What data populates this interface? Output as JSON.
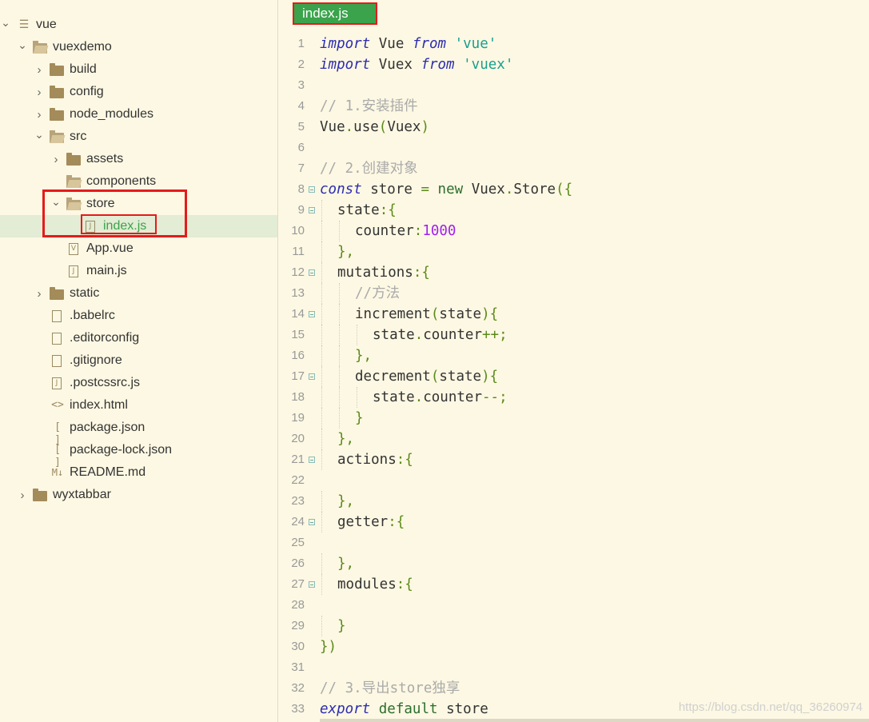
{
  "sidebar": {
    "tree": [
      {
        "label": "vue",
        "depth": 0,
        "icon": "file-list-icon",
        "chevron": "down",
        "selected": false
      },
      {
        "label": "vuexdemo",
        "depth": 1,
        "icon": "folder-open-icon",
        "chevron": "down",
        "selected": false
      },
      {
        "label": "build",
        "depth": 2,
        "icon": "folder-icon",
        "chevron": "right",
        "selected": false
      },
      {
        "label": "config",
        "depth": 2,
        "icon": "folder-icon",
        "chevron": "right",
        "selected": false
      },
      {
        "label": "node_modules",
        "depth": 2,
        "icon": "folder-icon",
        "chevron": "right",
        "selected": false
      },
      {
        "label": "src",
        "depth": 2,
        "icon": "folder-open-icon",
        "chevron": "down",
        "selected": false
      },
      {
        "label": "assets",
        "depth": 3,
        "icon": "folder-icon",
        "chevron": "right",
        "selected": false
      },
      {
        "label": "components",
        "depth": 3,
        "icon": "folder-open-icon",
        "chevron": "",
        "selected": false
      },
      {
        "label": "store",
        "depth": 3,
        "icon": "folder-open-icon",
        "chevron": "down",
        "selected": false
      },
      {
        "label": "index.js",
        "depth": 4,
        "icon": "js-file-icon",
        "chevron": "",
        "selected": true
      },
      {
        "label": "App.vue",
        "depth": 3,
        "icon": "vue-file-icon",
        "chevron": "",
        "selected": false
      },
      {
        "label": "main.js",
        "depth": 3,
        "icon": "js-file-icon",
        "chevron": "",
        "selected": false
      },
      {
        "label": "static",
        "depth": 2,
        "icon": "folder-icon",
        "chevron": "right",
        "selected": false
      },
      {
        "label": ".babelrc",
        "depth": 2,
        "icon": "file-icon",
        "chevron": "",
        "selected": false
      },
      {
        "label": ".editorconfig",
        "depth": 2,
        "icon": "file-icon",
        "chevron": "",
        "selected": false
      },
      {
        "label": ".gitignore",
        "depth": 2,
        "icon": "file-icon",
        "chevron": "",
        "selected": false
      },
      {
        "label": ".postcssrc.js",
        "depth": 2,
        "icon": "js-file-icon",
        "chevron": "",
        "selected": false
      },
      {
        "label": "index.html",
        "depth": 2,
        "icon": "html-file-icon",
        "chevron": "",
        "selected": false
      },
      {
        "label": "package.json",
        "depth": 2,
        "icon": "json-file-icon",
        "chevron": "",
        "selected": false
      },
      {
        "label": "package-lock.json",
        "depth": 2,
        "icon": "json-file-icon",
        "chevron": "",
        "selected": false
      },
      {
        "label": "README.md",
        "depth": 2,
        "icon": "markdown-file-icon",
        "chevron": "",
        "selected": false
      },
      {
        "label": "wyxtabbar",
        "depth": 1,
        "icon": "folder-icon",
        "chevron": "right",
        "selected": false
      }
    ]
  },
  "editor": {
    "tab_label": "index.js",
    "lines": [
      {
        "n": "1",
        "fold": false,
        "indent": 0,
        "tokens": [
          [
            "kw",
            "import"
          ],
          [
            "plain",
            " Vue "
          ],
          [
            "kw",
            "from"
          ],
          [
            "plain",
            " "
          ],
          [
            "str",
            "'vue'"
          ]
        ]
      },
      {
        "n": "2",
        "fold": false,
        "indent": 0,
        "tokens": [
          [
            "kw",
            "import"
          ],
          [
            "plain",
            " Vuex "
          ],
          [
            "kw",
            "from"
          ],
          [
            "plain",
            " "
          ],
          [
            "str",
            "'vuex'"
          ]
        ]
      },
      {
        "n": "3",
        "fold": false,
        "indent": 0,
        "tokens": []
      },
      {
        "n": "4",
        "fold": false,
        "indent": 0,
        "tokens": [
          [
            "cmt",
            "// 1.安装插件"
          ]
        ]
      },
      {
        "n": "5",
        "fold": false,
        "indent": 0,
        "tokens": [
          [
            "plain",
            "Vue"
          ],
          [
            "pn",
            "."
          ],
          [
            "plain",
            "use"
          ],
          [
            "pn",
            "("
          ],
          [
            "plain",
            "Vuex"
          ],
          [
            "pn",
            ")"
          ]
        ]
      },
      {
        "n": "6",
        "fold": false,
        "indent": 0,
        "tokens": []
      },
      {
        "n": "7",
        "fold": false,
        "indent": 0,
        "tokens": [
          [
            "cmt",
            "// 2.创建对象"
          ]
        ]
      },
      {
        "n": "8",
        "fold": true,
        "indent": 0,
        "tokens": [
          [
            "kw",
            "const"
          ],
          [
            "plain",
            " store "
          ],
          [
            "pn",
            "="
          ],
          [
            "plain",
            " "
          ],
          [
            "kw2",
            "new"
          ],
          [
            "plain",
            " Vuex"
          ],
          [
            "pn",
            "."
          ],
          [
            "plain",
            "Store"
          ],
          [
            "pn",
            "({"
          ]
        ]
      },
      {
        "n": "9",
        "fold": true,
        "indent": 1,
        "tokens": [
          [
            "plain",
            "state"
          ],
          [
            "pn",
            ":{"
          ]
        ]
      },
      {
        "n": "10",
        "fold": false,
        "indent": 2,
        "tokens": [
          [
            "plain",
            "counter"
          ],
          [
            "pn",
            ":"
          ],
          [
            "num",
            "1000"
          ]
        ]
      },
      {
        "n": "11",
        "fold": false,
        "indent": 1,
        "tokens": [
          [
            "pn",
            "},"
          ]
        ]
      },
      {
        "n": "12",
        "fold": true,
        "indent": 1,
        "tokens": [
          [
            "plain",
            "mutations"
          ],
          [
            "pn",
            ":{"
          ]
        ]
      },
      {
        "n": "13",
        "fold": false,
        "indent": 2,
        "tokens": [
          [
            "cmt",
            "//方法"
          ]
        ]
      },
      {
        "n": "14",
        "fold": true,
        "indent": 2,
        "tokens": [
          [
            "plain",
            "increment"
          ],
          [
            "pn",
            "("
          ],
          [
            "plain",
            "state"
          ],
          [
            "pn",
            "){"
          ]
        ]
      },
      {
        "n": "15",
        "fold": false,
        "indent": 3,
        "tokens": [
          [
            "plain",
            "state"
          ],
          [
            "pn",
            "."
          ],
          [
            "plain",
            "counter"
          ],
          [
            "pn",
            "++;"
          ]
        ]
      },
      {
        "n": "16",
        "fold": false,
        "indent": 2,
        "tokens": [
          [
            "pn",
            "},"
          ]
        ]
      },
      {
        "n": "17",
        "fold": true,
        "indent": 2,
        "tokens": [
          [
            "plain",
            "decrement"
          ],
          [
            "pn",
            "("
          ],
          [
            "plain",
            "state"
          ],
          [
            "pn",
            "){"
          ]
        ]
      },
      {
        "n": "18",
        "fold": false,
        "indent": 3,
        "tokens": [
          [
            "plain",
            "state"
          ],
          [
            "pn",
            "."
          ],
          [
            "plain",
            "counter"
          ],
          [
            "pn",
            "--;"
          ]
        ]
      },
      {
        "n": "19",
        "fold": false,
        "indent": 2,
        "tokens": [
          [
            "pn",
            "}"
          ]
        ]
      },
      {
        "n": "20",
        "fold": false,
        "indent": 1,
        "tokens": [
          [
            "pn",
            "},"
          ]
        ]
      },
      {
        "n": "21",
        "fold": true,
        "indent": 1,
        "tokens": [
          [
            "plain",
            "actions"
          ],
          [
            "pn",
            ":{"
          ]
        ]
      },
      {
        "n": "22",
        "fold": false,
        "indent": 0,
        "tokens": []
      },
      {
        "n": "23",
        "fold": false,
        "indent": 1,
        "tokens": [
          [
            "pn",
            "},"
          ]
        ]
      },
      {
        "n": "24",
        "fold": true,
        "indent": 1,
        "tokens": [
          [
            "plain",
            "getter"
          ],
          [
            "pn",
            ":{"
          ]
        ]
      },
      {
        "n": "25",
        "fold": false,
        "indent": 0,
        "tokens": []
      },
      {
        "n": "26",
        "fold": false,
        "indent": 1,
        "tokens": [
          [
            "pn",
            "},"
          ]
        ]
      },
      {
        "n": "27",
        "fold": true,
        "indent": 1,
        "tokens": [
          [
            "plain",
            "modules"
          ],
          [
            "pn",
            ":{"
          ]
        ]
      },
      {
        "n": "28",
        "fold": false,
        "indent": 0,
        "tokens": []
      },
      {
        "n": "29",
        "fold": false,
        "indent": 1,
        "tokens": [
          [
            "pn",
            "}"
          ]
        ]
      },
      {
        "n": "30",
        "fold": false,
        "indent": 0,
        "tokens": [
          [
            "pn",
            "})"
          ]
        ]
      },
      {
        "n": "31",
        "fold": false,
        "indent": 0,
        "tokens": []
      },
      {
        "n": "32",
        "fold": false,
        "indent": 0,
        "tokens": [
          [
            "cmt",
            "// 3.导出store独享"
          ]
        ]
      },
      {
        "n": "33",
        "fold": false,
        "indent": 0,
        "tokens": [
          [
            "kw",
            "export"
          ],
          [
            "plain",
            " "
          ],
          [
            "kw2",
            "default"
          ],
          [
            "plain",
            " store"
          ]
        ]
      }
    ]
  },
  "watermark": "https://blog.csdn.net/qq_36260974"
}
